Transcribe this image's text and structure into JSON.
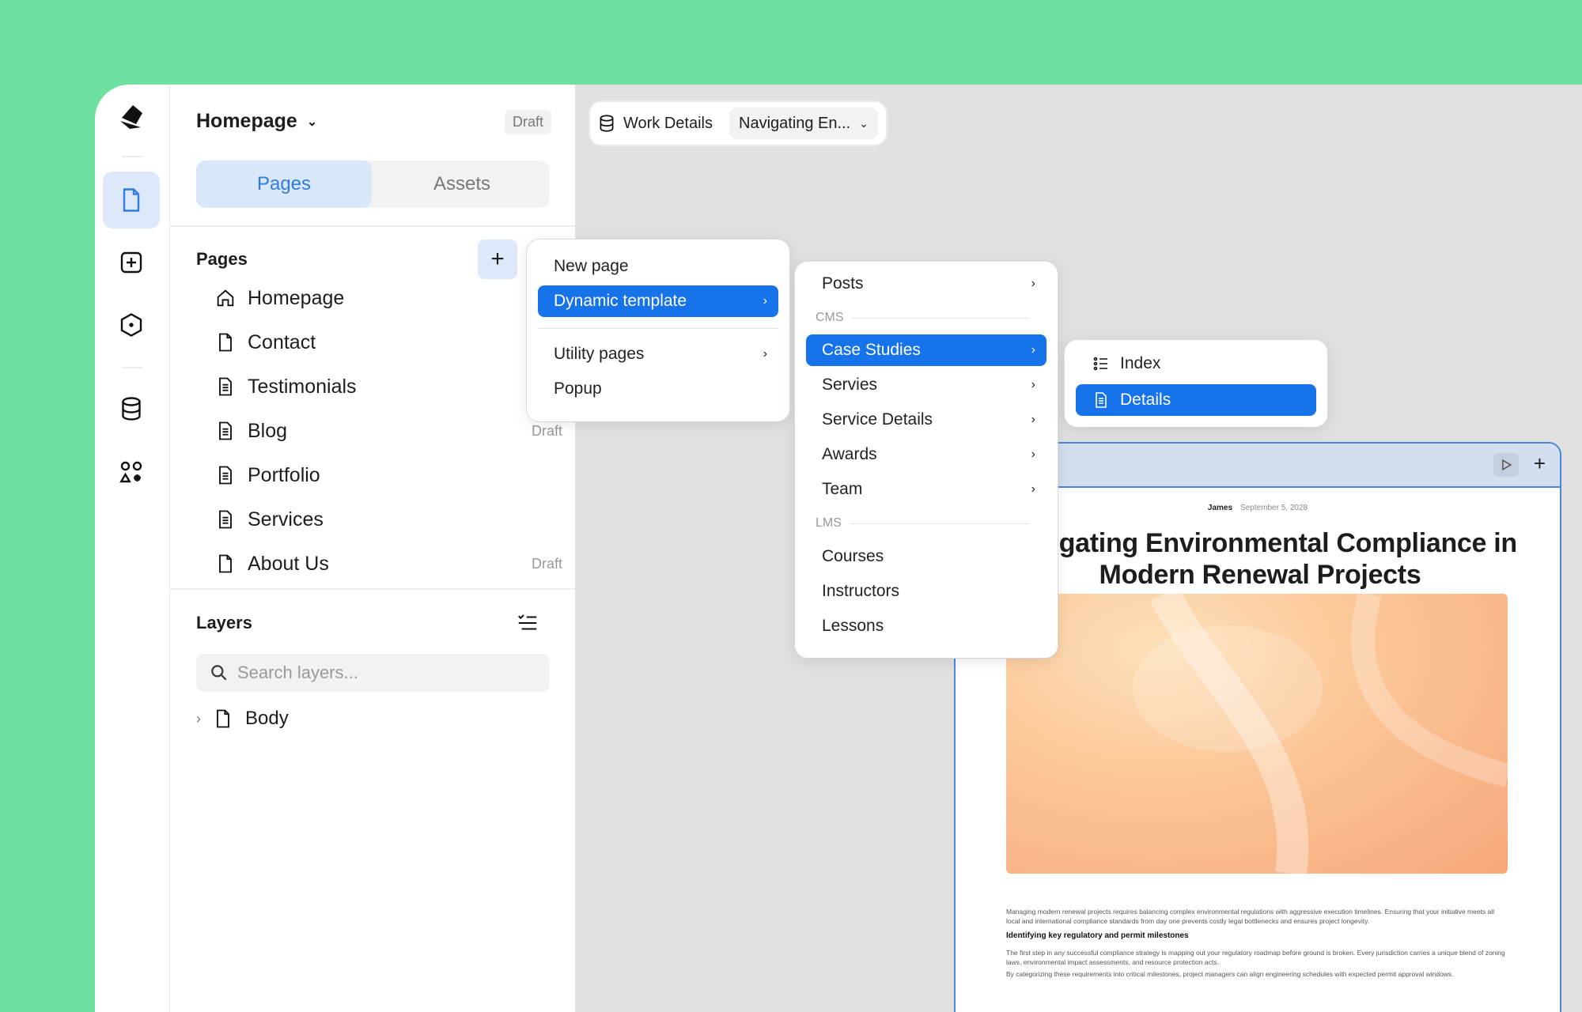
{
  "panel": {
    "title": "Homepage",
    "status": "Draft",
    "tabs": [
      "Pages",
      "Assets"
    ],
    "pages_heading": "Pages",
    "add_label": "+",
    "pages": [
      {
        "name": "Homepage",
        "icon": "home-icon",
        "draft": ""
      },
      {
        "name": "Contact",
        "icon": "page-icon",
        "draft": ""
      },
      {
        "name": "Testimonials",
        "icon": "page-text-icon",
        "draft": ""
      },
      {
        "name": "Blog",
        "icon": "page-text-icon",
        "draft": "Draft"
      },
      {
        "name": "Portfolio",
        "icon": "page-text-icon",
        "draft": ""
      },
      {
        "name": "Services",
        "icon": "page-text-icon",
        "draft": ""
      },
      {
        "name": "About Us",
        "icon": "page-icon",
        "draft": "Draft"
      }
    ],
    "layers_heading": "Layers",
    "search_placeholder": "Search layers...",
    "layer_root": "Body"
  },
  "toolbar": {
    "collection": "Work Details",
    "item": "Navigating En..."
  },
  "menu1": {
    "items": [
      "New page",
      "Dynamic template",
      "Utility pages",
      "Popup"
    ]
  },
  "menu2": {
    "items": [
      "Posts",
      "Case Studies",
      "Servies",
      "Service Details",
      "Awards",
      "Team",
      "Courses",
      "Instructors",
      "Lessons"
    ],
    "labels": [
      "CMS",
      "LMS"
    ]
  },
  "menu3": {
    "items": [
      "Index",
      "Details"
    ]
  },
  "article": {
    "author": "James",
    "date": "September 5, 2028",
    "title_line1": "Navigating Environmental Compliance in",
    "title_line2": "Modern Renewal Projects",
    "para1": "Managing modern renewal projects requires balancing complex environmental regulations with aggressive execution timelines. Ensuring that your initiative meets all local and international compliance standards from day one prevents costly legal bottlenecks and ensures project longevity.",
    "subhead": "Identifying key regulatory and permit milestones",
    "para2": "The first step in any successful compliance strategy is mapping out your regulatory roadmap before ground is broken. Every jurisdiction carries a unique blend of zoning laws, environmental impact assessments, and resource protection acts.",
    "para3": "By categorizing these requirements into critical milestones, project managers can align engineering schedules with expected permit approval windows."
  },
  "colors": {
    "accent": "#1773ea",
    "background": "#6ee0a0"
  }
}
